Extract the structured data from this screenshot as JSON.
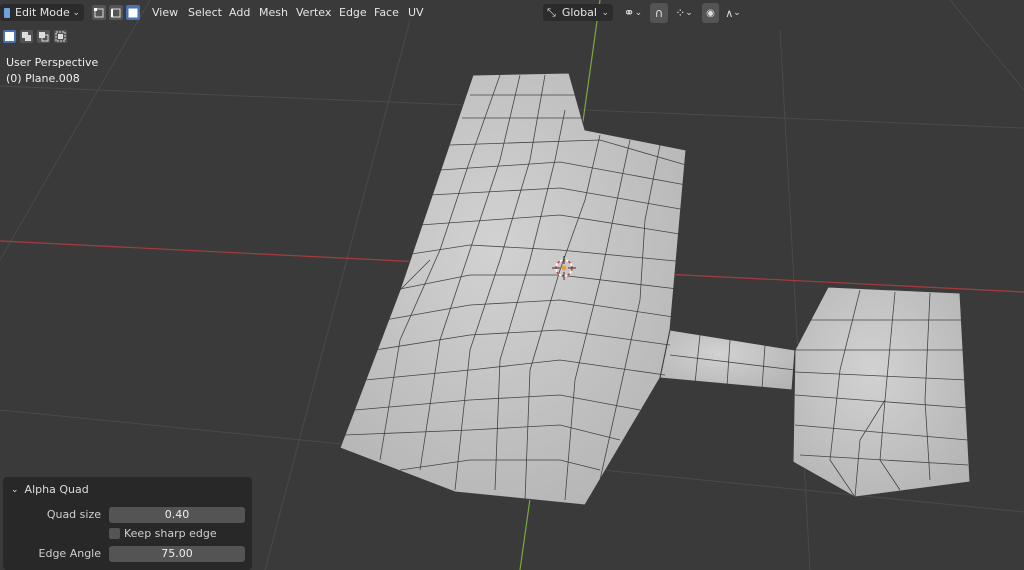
{
  "header": {
    "mode": "Edit Mode",
    "menu": [
      "View",
      "Select",
      "Add",
      "Mesh",
      "Vertex",
      "Edge",
      "Face",
      "UV"
    ],
    "transform_orientation": "Global"
  },
  "viewport": {
    "view_name": "User Perspective",
    "object_name": "(0) Plane.008"
  },
  "operator_panel": {
    "title": "Alpha Quad",
    "quad_size_label": "Quad size",
    "quad_size_value": "0.40",
    "keep_sharp_label": "Keep sharp edge",
    "keep_sharp_checked": false,
    "edge_angle_label": "Edge Angle",
    "edge_angle_value": "75.00"
  },
  "colors": {
    "background": "#3a3a3a",
    "grid": "#4a4a4a",
    "x_axis": "#a83a3e",
    "y_axis": "#7aa83a",
    "mesh_face": "#c6c6c6",
    "mesh_edge": "#333333",
    "active_button": "#4772b3"
  }
}
